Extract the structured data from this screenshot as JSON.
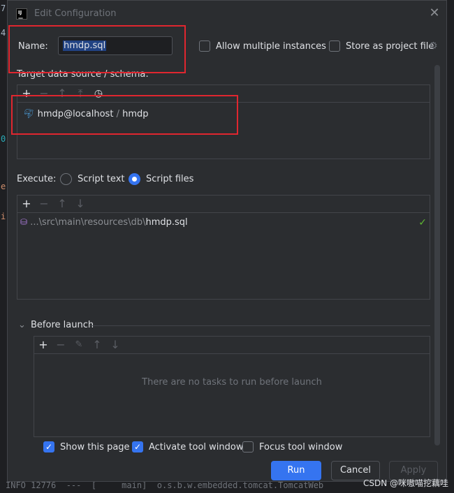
{
  "dialog": {
    "title": "Edit Configuration",
    "close_icon": "close-icon"
  },
  "name_row": {
    "name_label": "Name:",
    "name_value": "hmdp.sql",
    "allow_multiple_label": "Allow multiple instances",
    "store_project_label": "Store as project file"
  },
  "target": {
    "label": "Target data source / schema:",
    "datasource": "hmdp@localhost",
    "separator": "/",
    "schema": "hmdp"
  },
  "execute": {
    "label": "Execute:",
    "option_script_text": "Script text",
    "option_script_files": "Script files",
    "selected": "Script files",
    "file_path_prefix": "...\\src\\main\\resources\\db\\",
    "file_name": "hmdp.sql"
  },
  "before_launch": {
    "label": "Before launch",
    "empty_text": "There are no tasks to run before launch"
  },
  "options": {
    "show_this_page": "Show this page",
    "activate_tool_window": "Activate tool window",
    "focus_tool_window": "Focus tool window"
  },
  "buttons": {
    "run": "Run",
    "cancel": "Cancel",
    "apply": "Apply"
  },
  "watermark": "CSDN @咪嗷喵挖藕哇",
  "colors": {
    "accent": "#3574f0",
    "annotation": "#e0262f",
    "dialog_bg": "#2b2d30",
    "check_ok": "#5fb832"
  }
}
